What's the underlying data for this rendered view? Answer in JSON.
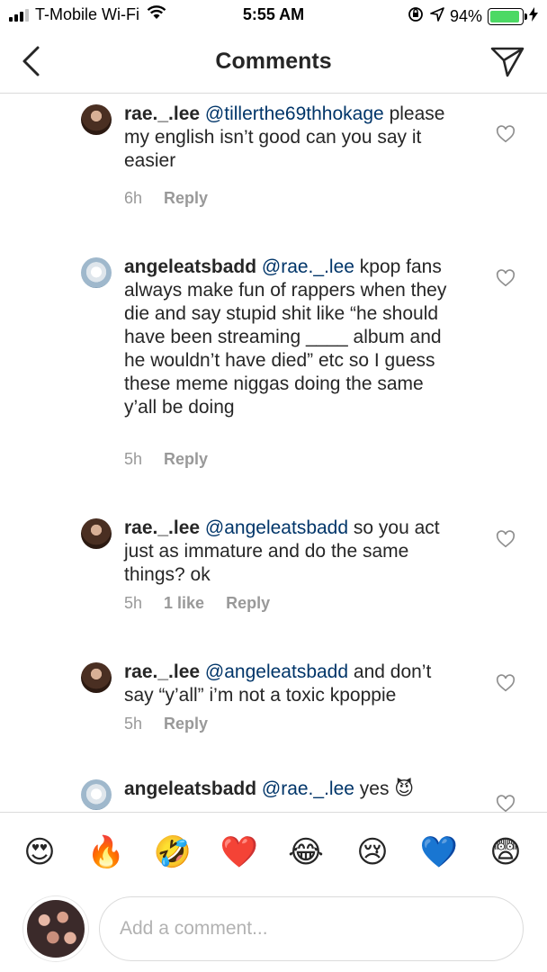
{
  "status_bar": {
    "carrier": "T-Mobile Wi-Fi",
    "time": "5:55 AM",
    "battery": "94%",
    "battery_level": 0.94
  },
  "header": {
    "title": "Comments"
  },
  "comments": [
    {
      "username": "rae._.lee",
      "mention": "@tillerthe69thhokage",
      "text": "please my english isn’t good can you say it easier",
      "time": "6h",
      "likes": "",
      "reply": "Reply"
    },
    {
      "username": "angeleatsbadd",
      "mention": "@rae._.lee",
      "text": "kpop fans always make fun of rappers when they die and say stupid shit like “he should have been streaming ____ album and he wouldn’t have died” etc so I guess these meme niggas doing the same y’all be doing",
      "time": "5h",
      "likes": "",
      "reply": "Reply"
    },
    {
      "username": "rae._.lee",
      "mention": "@angeleatsbadd",
      "text": "so you act just as immature and do the same things? ok",
      "time": "5h",
      "likes": "1 like",
      "reply": "Reply"
    },
    {
      "username": "rae._.lee",
      "mention": "@angeleatsbadd",
      "text": "and don’t say “y’all” i’m not a toxic kpoppie",
      "time": "5h",
      "likes": "",
      "reply": "Reply"
    },
    {
      "username": "angeleatsbadd",
      "mention": "@rae._.lee",
      "text": "yes 😈",
      "time": "",
      "likes": "",
      "reply": ""
    }
  ],
  "emoji_bar": [
    "😍",
    "🔥",
    "🤣",
    "❤️",
    "😂",
    "😢",
    "💙",
    "😨"
  ],
  "composer": {
    "placeholder": "Add a comment..."
  },
  "colors": {
    "text": "#262626",
    "mention": "#003569",
    "meta": "#999999",
    "divider": "#dbdbdb",
    "battery": "#4cd964"
  },
  "icons": {
    "back": "chevron-left-icon",
    "send": "paper-plane-icon",
    "like": "heart-outline-icon"
  }
}
